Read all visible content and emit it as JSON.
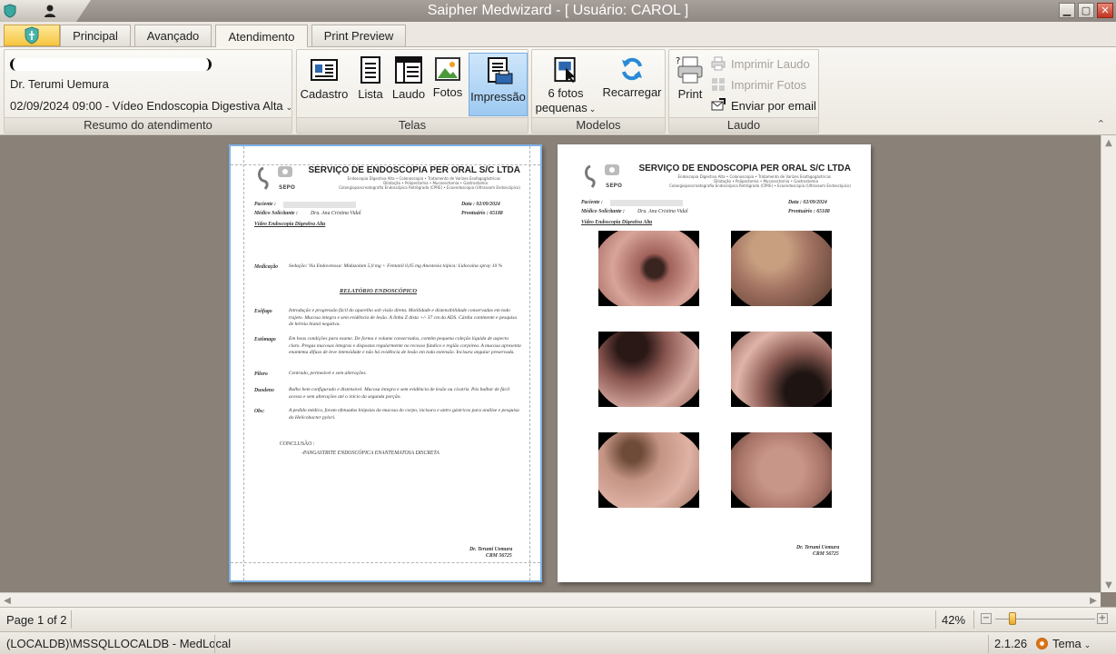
{
  "window": {
    "title": "Saipher Medwizard - [ Usuário: CAROL ]"
  },
  "tabs": [
    "Principal",
    "Avançado",
    "Atendimento",
    "Print Preview"
  ],
  "active_tab": "Atendimento",
  "resumo": {
    "doctor": "Dr. Terumi Uemura",
    "exam": "02/09/2024 09:00 - Vídeo Endoscopia Digestiva Alta",
    "label": "Resumo do atendimento"
  },
  "telas": {
    "label": "Telas",
    "buttons": [
      "Cadastro",
      "Lista",
      "Laudo",
      "Fotos",
      "Impressão"
    ]
  },
  "modelos": {
    "label": "Modelos",
    "fotos_line1": "6 fotos",
    "fotos_line2": "pequenas",
    "recarregar": "Recarregar"
  },
  "laudo": {
    "label": "Laudo",
    "print": "Print",
    "imprimir_laudo": "Imprimir Laudo",
    "imprimir_fotos": "Imprimir Fotos",
    "enviar_email": "Enviar por email"
  },
  "report": {
    "header_title": "SERVIÇO DE ENDOSCOPIA PER ORAL S/C LTDA",
    "header_sub1": "Endoscopia Digestiva Alta • Colonoscopia • Tratamento de Varizes Esofagogástricas",
    "header_sub2": "Dilatação • Polipectomia • Mucosectomia • Gastrostomia",
    "header_sub3": "Colangiopancreatografia Endoscópica Retrógrada (CPRE) • Ecoendoscopia (Ultrassom Endoscópico)",
    "logo_text": "SEPO",
    "paciente_label": "Paciente :",
    "data_label": "Data : 02/09/2024",
    "medico_label": "Médico Solicitante :",
    "medico_value": "Dra. Ana Cristina Vidal",
    "prontuario_label": "Prontuário : 65188",
    "exam_title": "Vídeo Endoscopia Digestiva Alta",
    "medicacao_label": "Medicação",
    "medicacao_text": "Sedação: Via Endovenosa: Midazolam 5,0 mg + Fentanil 0,05 mg Anestesia tópica: Lidocaína spray 10 %",
    "relatorio_title": "RELATÓRIO ENDOSCÓPICO",
    "esofago_label": "Esôfago",
    "esofago_text": "Introdução e progressão fácil do aparelho sob visão direta. Motilidade e distensibilidade conservadas em todo trajeto. Mucosa íntegra e sem evidência de lesão. A linha Z dista +/- 37 cm da ADS. Cárdia continente e pesquisa de hérnia hiatal negativa.",
    "estomago_label": "Estômago",
    "estomago_text": "Em boas condições para exame. De forma e volume conservados, contém pequena coleção líquida de aspecto claro. Pregas mucosas íntegras e dispostas regularmente no recesso fúndico e região corpórea. A mucosa apresenta enantema difuso de leve intensidade e não há evidência de lesão em toda extensão. Incisura angular preservada.",
    "piloro_label": "Piloro",
    "piloro_text": "Centrado, permeável e sem alterações.",
    "duodeno_label": "Duodeno",
    "duodeno_text": "Bulbo bem configurado e distensível. Mucosa íntegra e sem evidência de lesão ou cicatriz. Pós bulbar de fácil acesso e sem alterações até o início da segunda porção.",
    "obs_label": "Obs:",
    "obs_text": "A pedido médico, foram efetuadas biópsias da mucosa do corpo, incisura e antro gástricos para análise e pesquisa do Helicobacter pylori.",
    "conclusao_label": "CONCLUSÃO :",
    "conclusao_text": "-PANGASTRITE ENDOSCÓPICA ENANTEMATOSA DISCRETA",
    "sign_name": "Dr. Terumi Uemura",
    "sign_crm": "CRM 56725"
  },
  "status": {
    "page": "Page 1 of 2",
    "zoom": "42%",
    "connection": "(LOCALDB)\\MSSQLLOCALDB - MedLocal",
    "version": "2.1.26",
    "theme": "Tema"
  },
  "colors": {
    "titlebar": "#968e88",
    "ribbon_active": "#9cc9f1",
    "viewer_bg": "#8a8178",
    "app_button": "#f6c53f"
  }
}
